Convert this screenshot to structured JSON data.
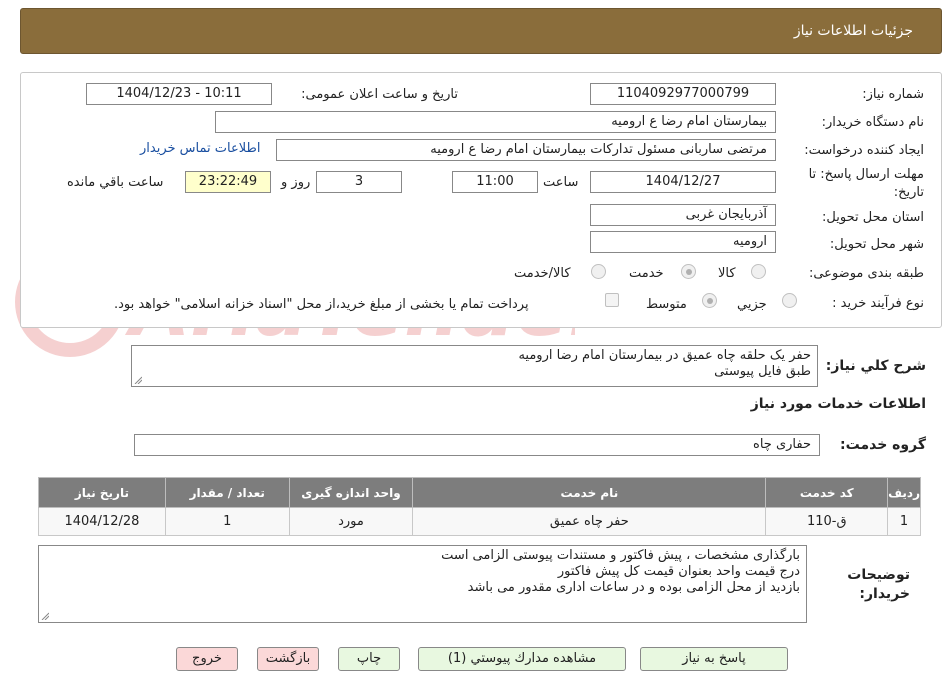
{
  "header": {
    "title": "جزئیات اطلاعات نیاز"
  },
  "form": {
    "need_number": {
      "label": "شماره نیاز:",
      "value": "1104092977000799"
    },
    "announce_datetime": {
      "label": "تاریخ و ساعت اعلان عمومی:",
      "value": "1404/12/23 - 10:11"
    },
    "buyer_org": {
      "label": "نام دستگاه خریدار:",
      "value": "بیمارستان امام رضا  ع  ارومیه"
    },
    "requester": {
      "label": "ایجاد کننده درخواست:",
      "value": "مرتضی ساربانی مسئول تدارکات بیمارستان امام رضا  ع  ارومیه"
    },
    "contact_link": "اطلاعات تماس خریدار",
    "deadline": {
      "label_line1": "مهلت ارسال پاسخ: تا",
      "label_line2": "تاریخ:",
      "date": "1404/12/27",
      "time_label": "ساعت",
      "time": "11:00",
      "days": "3",
      "days_label": "روز و",
      "remaining": "23:22:49",
      "remaining_label": "ساعت باقي مانده"
    },
    "province": {
      "label": "استان محل تحویل:",
      "value": "آذربایجان غربی"
    },
    "city": {
      "label": "شهر محل تحویل:",
      "value": "ارومیه"
    },
    "category": {
      "label": "طبقه بندی موضوعی:",
      "options": [
        "کالا",
        "خدمت",
        "کالا/خدمت"
      ],
      "selected": "خدمت"
    },
    "process_type": {
      "label": "نوع فرآیند خرید :",
      "options": [
        "جزيي",
        "متوسط"
      ],
      "selected": "متوسط",
      "payment_note": "پرداخت تمام یا بخشی از مبلغ خرید،از محل \"اسناد خزانه اسلامی\" خواهد بود."
    }
  },
  "description": {
    "label": "شرح كلي نياز:",
    "lines": [
      "حفر یک حلقه چاه عمیق در بیمارستان امام رضا ارومیه",
      "طبق فایل پیوستی"
    ]
  },
  "services": {
    "section_title": "اطلاعات خدمات مورد نیاز",
    "group_label": "گروه خدمت:",
    "group_value": "حفاری چاه",
    "table": {
      "headers": [
        "ردیف",
        "کد خدمت",
        "نام خدمت",
        "واحد اندازه گیری",
        "تعداد / مقدار",
        "تاریخ نیاز"
      ],
      "rows": [
        [
          "1",
          "ق-110",
          "حفر چاه عمیق",
          "مورد",
          "1",
          "1404/12/28"
        ]
      ]
    }
  },
  "buyer_notes": {
    "label_line1": "توضیحات",
    "label_line2": "خریدار:",
    "lines": [
      "بارگذاری مشخصات ، پیش فاکتور و مستندات پیوستی الزامی است",
      "درج قیمت واحد بعنوان قیمت کل پیش فاکتور",
      "بازدید از محل الزامی بوده و در ساعات اداری مقدور می باشد"
    ]
  },
  "buttons": {
    "reply": "پاسخ به نیاز",
    "attachments": "مشاهده مدارك پيوستي (1)",
    "print": "چاپ",
    "back": "بازگشت",
    "exit": "خروج"
  },
  "watermark_text": "AriaTender.neT",
  "colors": {
    "header_bg": "#8a6d3b",
    "table_header_bg": "#7d7d7d",
    "link": "#1a4fa0"
  }
}
